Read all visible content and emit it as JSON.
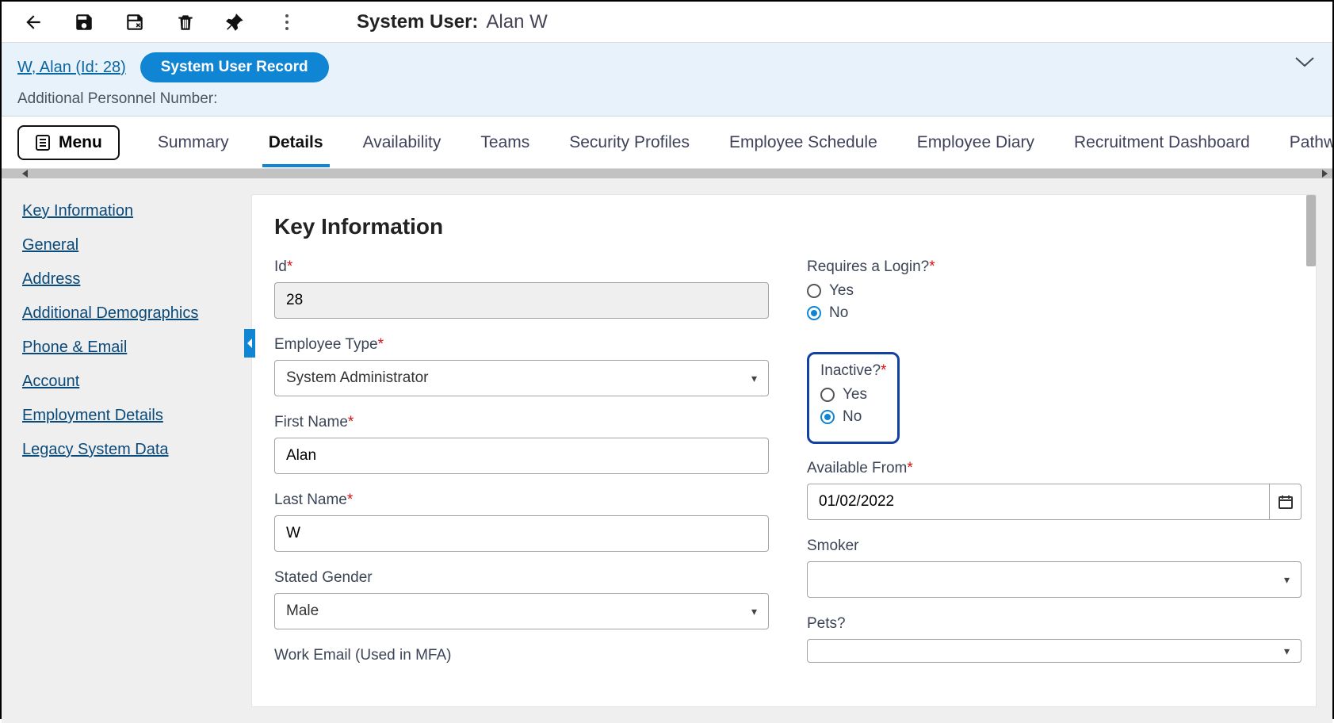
{
  "topbar": {
    "title_label": "System User:",
    "title_value": "Alan W"
  },
  "context": {
    "link_text": "W, Alan (Id: 28)",
    "pill_label": "System User Record",
    "sub_label": "Additional Personnel Number:"
  },
  "tabs": {
    "menu_label": "Menu",
    "items": [
      "Summary",
      "Details",
      "Availability",
      "Teams",
      "Security Profiles",
      "Employee Schedule",
      "Employee Diary",
      "Recruitment Dashboard",
      "Pathways"
    ],
    "active_index": 1
  },
  "sidenav": {
    "items": [
      "Key Information",
      "General",
      "Address",
      "Additional Demographics",
      "Phone & Email",
      "Account",
      "Employment Details",
      "Legacy System Data"
    ]
  },
  "form": {
    "heading": "Key Information",
    "id_label": "Id",
    "id_value": "28",
    "employee_type_label": "Employee Type",
    "employee_type_value": "System Administrator",
    "first_name_label": "First Name",
    "first_name_value": "Alan",
    "last_name_label": "Last Name",
    "last_name_value": "W",
    "gender_label": "Stated Gender",
    "gender_value": "Male",
    "work_email_label": "Work Email (Used in MFA)",
    "requires_login_label": "Requires a Login?",
    "yes_label": "Yes",
    "no_label": "No",
    "inactive_label": "Inactive?",
    "available_from_label": "Available From",
    "available_from_value": "01/02/2022",
    "smoker_label": "Smoker",
    "smoker_value": "",
    "pets_label": "Pets?",
    "pets_value": ""
  }
}
